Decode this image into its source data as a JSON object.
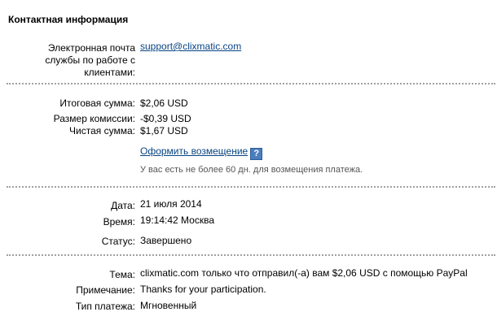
{
  "contact": {
    "title": "Контактная информация",
    "email_label": "Электронная почта службы по работе с клиентами:",
    "email_label_lines": [
      "Электронная почта",
      "службы по работе с",
      "клиентами:"
    ],
    "email": "support@clixmatic.com"
  },
  "amounts": {
    "total_label": "Итоговая сумма:",
    "total_value": "$2,06 USD",
    "fee_label": "Размер комиссии:",
    "fee_value": "-$0,39 USD",
    "net_label": "Чистая сумма:",
    "net_value": "$1,67 USD",
    "refund_link": "Оформить возмещение",
    "help_icon": "?",
    "refund_note": "У вас есть не более 60 дн. для возмещения платежа."
  },
  "details": {
    "date_label": "Дата:",
    "date_value": "21 июля 2014",
    "time_label": "Время:",
    "time_value": "19:14:42 Москва",
    "status_label": "Статус:",
    "status_value": "Завершено"
  },
  "message": {
    "subject_label": "Тема:",
    "subject_value": "clixmatic.com только что отправил(-а) вам $2,06 USD с помощью PayPal",
    "note_label": "Примечание:",
    "note_value": "Thanks for your participation.",
    "type_label": "Тип платежа:",
    "type_value": "Мгновенный"
  },
  "colors": {
    "link": "#084482",
    "help_icon": "#4a7ebf",
    "divider": "#a0a0a0"
  }
}
